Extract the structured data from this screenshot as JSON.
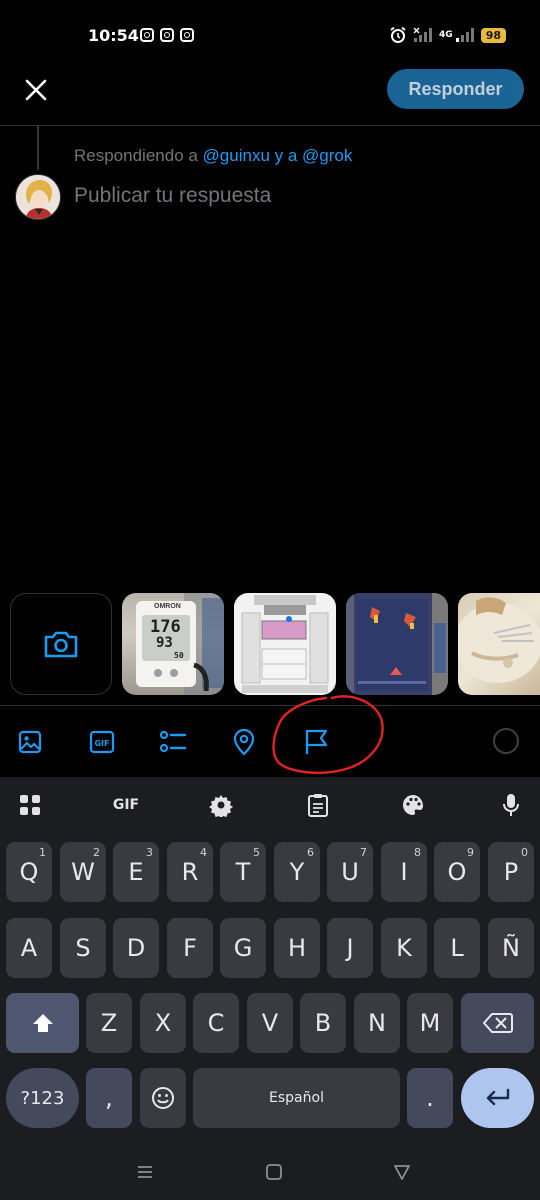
{
  "status_bar": {
    "time": "10:54",
    "network": "4G",
    "battery": "98"
  },
  "header": {
    "reply_button_label": "Responder"
  },
  "compose": {
    "replying_prefix": "Respondiendo a ",
    "mention_text": "@guinxu y a @grok",
    "placeholder": "Publicar tu respuesta"
  },
  "media_strip": {
    "photos": [
      {
        "subject": "blood pressure monitor",
        "brand": "OMRON",
        "reading_sys": "176",
        "reading_dia": "93",
        "reading_pulse": "50"
      },
      {
        "subject": "floor plan map"
      },
      {
        "subject": "arcade shooter game"
      },
      {
        "subject": "food plate"
      }
    ]
  },
  "toolbar": {
    "icons": [
      "image-icon",
      "gif-icon",
      "poll-icon",
      "location-icon",
      "flag-icon"
    ],
    "accent_color": "#1d9bf0"
  },
  "keyboard": {
    "gif_label": "GIF",
    "row1": [
      {
        "key": "Q",
        "num": "1"
      },
      {
        "key": "W",
        "num": "2"
      },
      {
        "key": "E",
        "num": "3"
      },
      {
        "key": "R",
        "num": "4"
      },
      {
        "key": "T",
        "num": "5"
      },
      {
        "key": "Y",
        "num": "6"
      },
      {
        "key": "U",
        "num": "7"
      },
      {
        "key": "I",
        "num": "8"
      },
      {
        "key": "O",
        "num": "9"
      },
      {
        "key": "P",
        "num": "0"
      }
    ],
    "row2": [
      "A",
      "S",
      "D",
      "F",
      "G",
      "H",
      "J",
      "K",
      "L",
      "Ñ"
    ],
    "row3": [
      "Z",
      "X",
      "C",
      "V",
      "B",
      "N",
      "M"
    ],
    "symbols_label": "?123",
    "comma_label": ",",
    "space_label": "Español",
    "period_label": "."
  }
}
